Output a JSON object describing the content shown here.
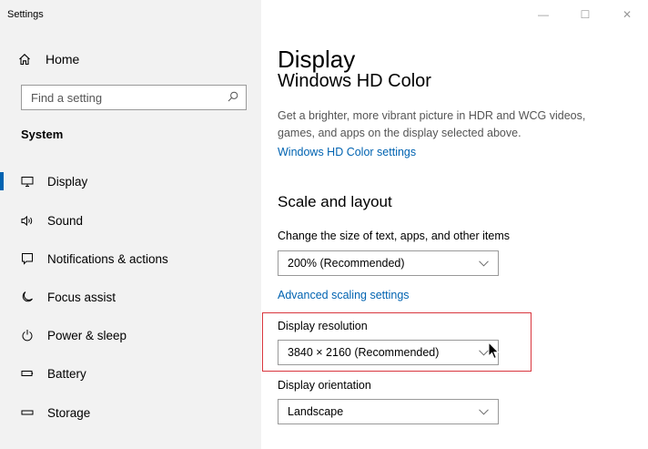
{
  "window": {
    "title": "Settings",
    "minimize_glyph": "—",
    "maximize_glyph": "☐",
    "close_glyph": "✕"
  },
  "sidebar": {
    "home_label": "Home",
    "search_placeholder": "Find a setting",
    "section_title": "System",
    "items": [
      {
        "label": "Display",
        "icon": "monitor-icon",
        "selected": true
      },
      {
        "label": "Sound",
        "icon": "speaker-icon",
        "selected": false
      },
      {
        "label": "Notifications & actions",
        "icon": "notification-icon",
        "selected": false
      },
      {
        "label": "Focus assist",
        "icon": "moon-icon",
        "selected": false
      },
      {
        "label": "Power & sleep",
        "icon": "power-icon",
        "selected": false
      },
      {
        "label": "Battery",
        "icon": "battery-icon",
        "selected": false
      },
      {
        "label": "Storage",
        "icon": "storage-icon",
        "selected": false
      }
    ]
  },
  "main": {
    "page_title": "Display",
    "hd_color_heading": "Windows HD Color",
    "hd_color_description": "Get a brighter, more vibrant picture in HDR and WCG videos, games, and apps on the display selected above.",
    "hd_color_link": "Windows HD Color settings",
    "scale_heading": "Scale and layout",
    "scale_label": "Change the size of text, apps, and other items",
    "scale_value": "200% (Recommended)",
    "advanced_scaling_link": "Advanced scaling settings",
    "resolution_label": "Display resolution",
    "resolution_value": "3840 × 2160 (Recommended)",
    "orientation_label": "Display orientation",
    "orientation_value": "Landscape"
  },
  "colors": {
    "accent": "#0063b1",
    "highlight": "#d9363e"
  }
}
